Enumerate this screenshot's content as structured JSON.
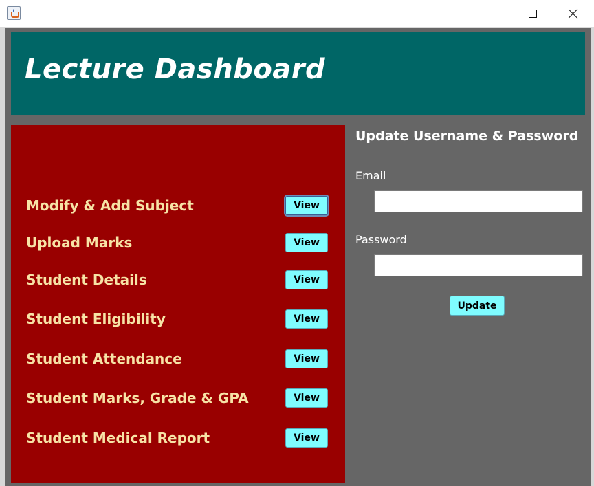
{
  "window": {
    "icon": "java-cup-icon",
    "controls": [
      "minimize-icon",
      "maximize-icon",
      "close-icon"
    ]
  },
  "header": {
    "title": "Lecture Dashboard"
  },
  "menu": {
    "items": [
      {
        "label": "Modify & Add Subject",
        "button": "View"
      },
      {
        "label": "Upload Marks",
        "button": "View"
      },
      {
        "label": "Student Details",
        "button": "View"
      },
      {
        "label": "Student Eligibility",
        "button": "View"
      },
      {
        "label": "Student Attendance",
        "button": "View"
      },
      {
        "label": "Student Marks, Grade & GPA",
        "button": "View"
      },
      {
        "label": "Student Medical Report",
        "button": "View"
      }
    ]
  },
  "account": {
    "title": "Update Username & Password",
    "email_label": "Email",
    "email_value": "",
    "password_label": "Password",
    "password_value": "",
    "update_label": "Update"
  },
  "colors": {
    "header_bg": "#006666",
    "panel_bg": "#990000",
    "content_bg": "#666666",
    "button_bg": "#7ffcff",
    "menu_text": "#f7e3a6"
  }
}
